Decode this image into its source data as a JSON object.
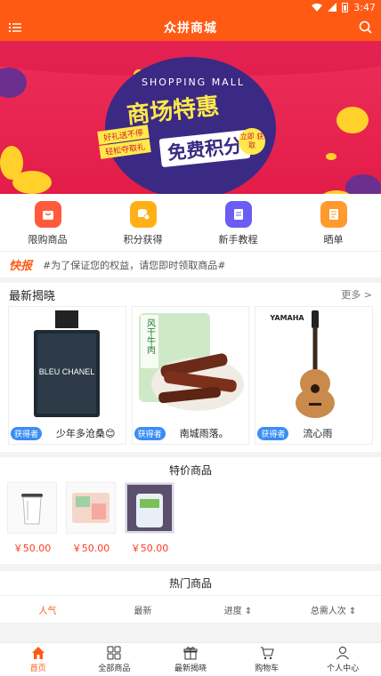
{
  "status": {
    "time": "3:47"
  },
  "header": {
    "title": "众拼商城"
  },
  "banner": {
    "shopping_mall": "SHOPPING MALL",
    "headline": "商场特惠",
    "tag1": "好礼送不停",
    "tag2": "轻松夺取礼",
    "subheadline": "免费积分",
    "badge": "立即 获取"
  },
  "quick_nav": [
    {
      "label": "限购商品",
      "color": "#ff5a3c"
    },
    {
      "label": "积分获得",
      "color": "#ffb016"
    },
    {
      "label": "新手教程",
      "color": "#6b5cf3"
    },
    {
      "label": "晒单",
      "color": "#ff9a2f"
    }
  ],
  "ticker": {
    "label": "快报",
    "text": "#为了保证您的权益，请您即时领取商品#"
  },
  "latest_reveal": {
    "title": "最新揭晓",
    "more": "更多",
    "items": [
      {
        "winner_tag": "获得者",
        "name": "少年多沧桑😊",
        "product_text": "BLEU CHANEL"
      },
      {
        "winner_tag": "获得者",
        "name": "南城雨落。",
        "product_text": "风干牛肉"
      },
      {
        "winner_tag": "获得者",
        "name": "流心雨",
        "product_text": "YAMAHA"
      }
    ]
  },
  "special": {
    "title": "特价商品",
    "items": [
      {
        "price": "￥50.00"
      },
      {
        "price": "￥50.00"
      },
      {
        "price": "￥50.00"
      }
    ]
  },
  "hot": {
    "title": "热门商品",
    "sorts": [
      "人气",
      "最新",
      "进度 ⇕",
      "总需人次 ⇕"
    ]
  },
  "tabbar": [
    {
      "label": "首页"
    },
    {
      "label": "全部商品"
    },
    {
      "label": "最新揭晓"
    },
    {
      "label": "购物车"
    },
    {
      "label": "个人中心"
    }
  ],
  "colors": {
    "brand": "#ff5a14",
    "price": "#ff3b1f",
    "winner": "#3a8df5"
  }
}
